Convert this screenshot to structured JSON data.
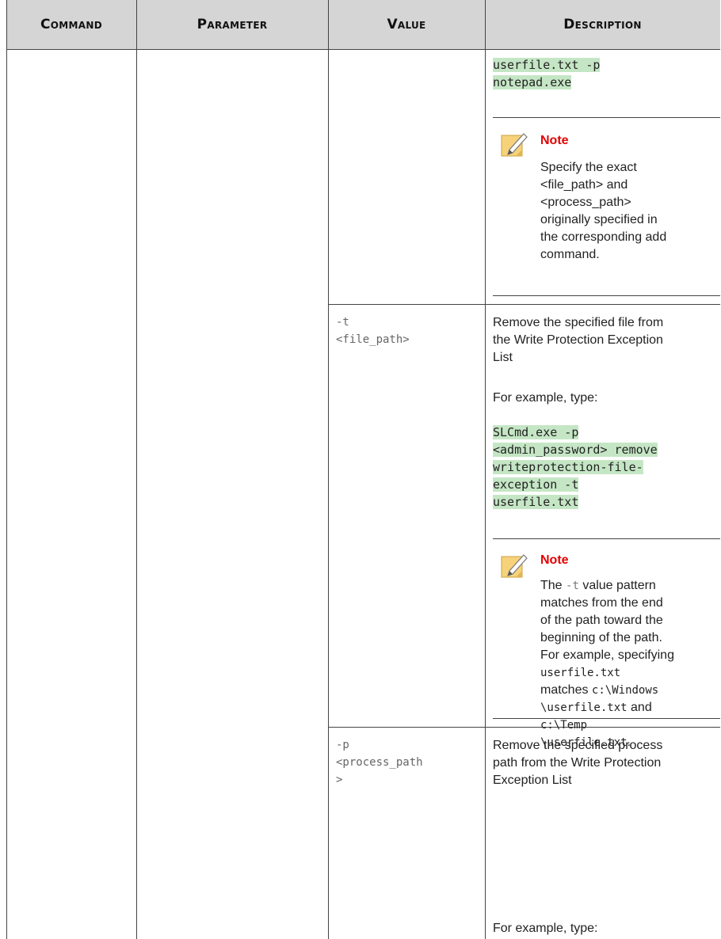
{
  "headers": {
    "command": "Command",
    "parameter": "Parameter",
    "value": "Value",
    "description": "Description"
  },
  "top_row": {
    "code_lines": [
      "userfile.txt -p",
      "notepad.exe"
    ],
    "note": {
      "title": "Note",
      "lines": [
        "Specify the exact",
        "<file_path> and",
        "<process_path>",
        "originally specified in",
        "the corresponding add",
        "command."
      ]
    }
  },
  "row_t": {
    "value_lines": [
      "-t",
      "<file_path>"
    ],
    "desc_lines": [
      "Remove the specified file from",
      "the Write Protection Exception",
      "List"
    ],
    "example_label": "For example, type:",
    "code_lines": [
      "SLCmd.exe -p",
      "<admin_password> remove",
      "writeprotection-file-",
      "exception -t",
      "userfile.txt"
    ],
    "note": {
      "title": "Note",
      "line1_pre": "The ",
      "line1_code": "-t",
      "line1_post": " value pattern",
      "lines": [
        "matches from the end",
        "of the path toward the",
        "beginning of the path.",
        "For example, specifying"
      ],
      "code1": "userfile.txt",
      "matches_label": "matches ",
      "code2": "c:\\Windows",
      "code3": "\\userfile.txt",
      "and_label": " and",
      "code4": "c:\\Temp",
      "code5": "\\userfile.txt",
      "end_punct": "."
    }
  },
  "row_p": {
    "value_lines": [
      "-p",
      "<process_path",
      ">"
    ],
    "desc_lines": [
      "Remove the specified process",
      "path from the Write Protection",
      "Exception List"
    ],
    "example_label": "For example, type:"
  }
}
